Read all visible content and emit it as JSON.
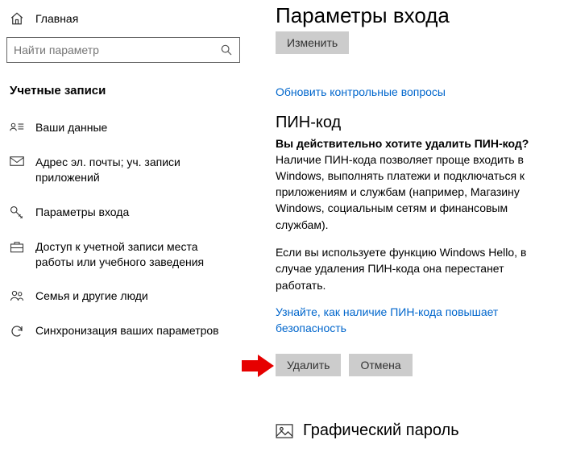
{
  "home_label": "Главная",
  "search_placeholder": "Найти параметр",
  "section_title": "Учетные записи",
  "nav": [
    {
      "label": "Ваши данные"
    },
    {
      "label": "Адрес эл. почты; уч. записи приложений"
    },
    {
      "label": "Параметры входа"
    },
    {
      "label": "Доступ к учетной записи места работы или учебного заведения"
    },
    {
      "label": "Семья и другие люди"
    },
    {
      "label": "Синхронизация ваших параметров"
    }
  ],
  "main": {
    "title": "Параметры входа",
    "change_btn": "Изменить",
    "update_link": "Обновить контрольные вопросы",
    "pin_heading": "ПИН-код",
    "pin_question": "Вы действительно хотите удалить ПИН-код?",
    "pin_para1": "Наличие ПИН-кода позволяет проще входить в Windows, выполнять платежи и подключаться к приложениям и службам (например, Магазину Windows, социальным сетям и финансовым службам).",
    "pin_para2": "Если вы используете функцию Windows Hello, в случае удаления ПИН-кода она перестанет работать.",
    "learn_link": "Узнайте, как наличие ПИН-кода повышает безопасность",
    "delete_btn": "Удалить",
    "cancel_btn": "Отмена",
    "picture_password": "Графический пароль"
  }
}
